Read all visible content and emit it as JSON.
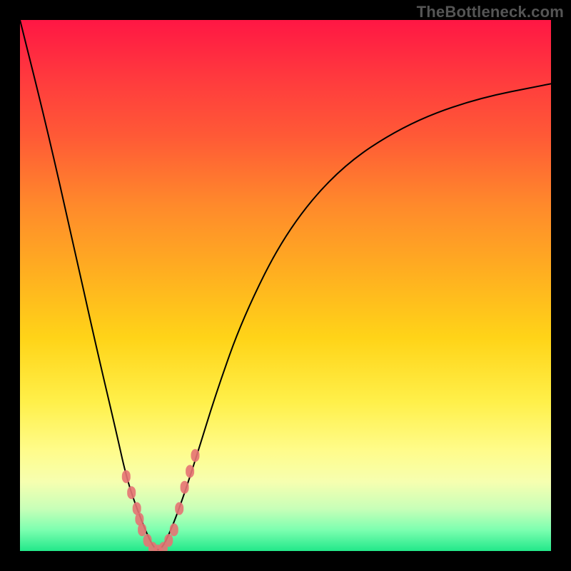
{
  "watermark": "TheBottleneck.com",
  "colors": {
    "frame": "#000000",
    "gradient_top": "#ff1744",
    "gradient_bottom": "#22e88a",
    "curve": "#000000",
    "marker": "#e57373"
  },
  "chart_data": {
    "type": "line",
    "title": "",
    "xlabel": "",
    "ylabel": "",
    "xlim": [
      0,
      100
    ],
    "ylim": [
      0,
      100
    ],
    "note": "Bottleneck-style V-curve. Values are approximate percentages read from the figure; no axis ticks or numeric labels are shown.",
    "series": [
      {
        "name": "bottleneck-curve",
        "x": [
          0,
          5,
          10,
          14,
          18,
          20,
          22,
          24,
          25,
          26,
          27,
          28,
          30,
          33,
          37,
          42,
          50,
          60,
          72,
          85,
          100
        ],
        "y": [
          100,
          80,
          58,
          40,
          23,
          14,
          8,
          3,
          1,
          0,
          1,
          3,
          8,
          17,
          30,
          44,
          60,
          72,
          80,
          85,
          88
        ]
      }
    ],
    "markers": {
      "name": "highlighted-points",
      "color": "#e57373",
      "points": [
        {
          "x": 20,
          "y": 14
        },
        {
          "x": 21,
          "y": 11
        },
        {
          "x": 22,
          "y": 8
        },
        {
          "x": 22.5,
          "y": 6
        },
        {
          "x": 23,
          "y": 4
        },
        {
          "x": 24,
          "y": 2
        },
        {
          "x": 25,
          "y": 0.5
        },
        {
          "x": 26,
          "y": 0
        },
        {
          "x": 27,
          "y": 0.5
        },
        {
          "x": 28,
          "y": 2
        },
        {
          "x": 29,
          "y": 4
        },
        {
          "x": 30,
          "y": 8
        },
        {
          "x": 31,
          "y": 12
        },
        {
          "x": 32,
          "y": 15
        },
        {
          "x": 33,
          "y": 18
        }
      ]
    }
  }
}
